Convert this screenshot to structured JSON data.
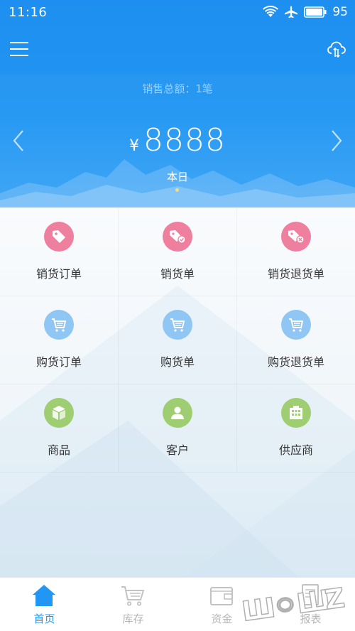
{
  "status_bar": {
    "time": "11:16",
    "battery": "95",
    "icons": [
      "wifi-icon",
      "airplane-icon",
      "battery-icon"
    ]
  },
  "toolbar": {
    "menu_icon": "hamburger-menu-icon",
    "sync_icon": "cloud-sync-icon"
  },
  "summary": {
    "sales_total_label": "销售总额：1笔",
    "currency": "¥",
    "amount": "8888",
    "period": "本日",
    "page_indicator_color": "#f7dc6f"
  },
  "grid": {
    "items": [
      {
        "label": "销货订单",
        "icon": "tag-icon",
        "color": "#ef7f9f"
      },
      {
        "label": "销货单",
        "icon": "tag-check-icon",
        "color": "#ef7f9f"
      },
      {
        "label": "销货退货单",
        "icon": "tag-return-icon",
        "color": "#ef7f9f"
      },
      {
        "label": "购货订单",
        "icon": "cart-list-icon",
        "color": "#8fc6f3"
      },
      {
        "label": "购货单",
        "icon": "cart-list-icon",
        "color": "#8fc6f3"
      },
      {
        "label": "购货退货单",
        "icon": "cart-list-icon",
        "color": "#8fc6f3"
      },
      {
        "label": "商品",
        "icon": "box-icon",
        "color": "#9fcd72"
      },
      {
        "label": "客户",
        "icon": "person-icon",
        "color": "#9fcd72"
      },
      {
        "label": "供应商",
        "icon": "building-icon",
        "color": "#9fcd72"
      }
    ]
  },
  "tabbar": {
    "active_color": "#2196f3",
    "inactive_color": "#b5b5b5",
    "tabs": [
      {
        "label": "首页",
        "icon": "home-icon",
        "active": true
      },
      {
        "label": "库存",
        "icon": "cart-icon",
        "active": false
      },
      {
        "label": "资金",
        "icon": "wallet-icon",
        "active": false
      },
      {
        "label": "报表",
        "icon": "report-icon",
        "active": false
      }
    ]
  },
  "theme": {
    "header_blue": "#2196f3"
  }
}
